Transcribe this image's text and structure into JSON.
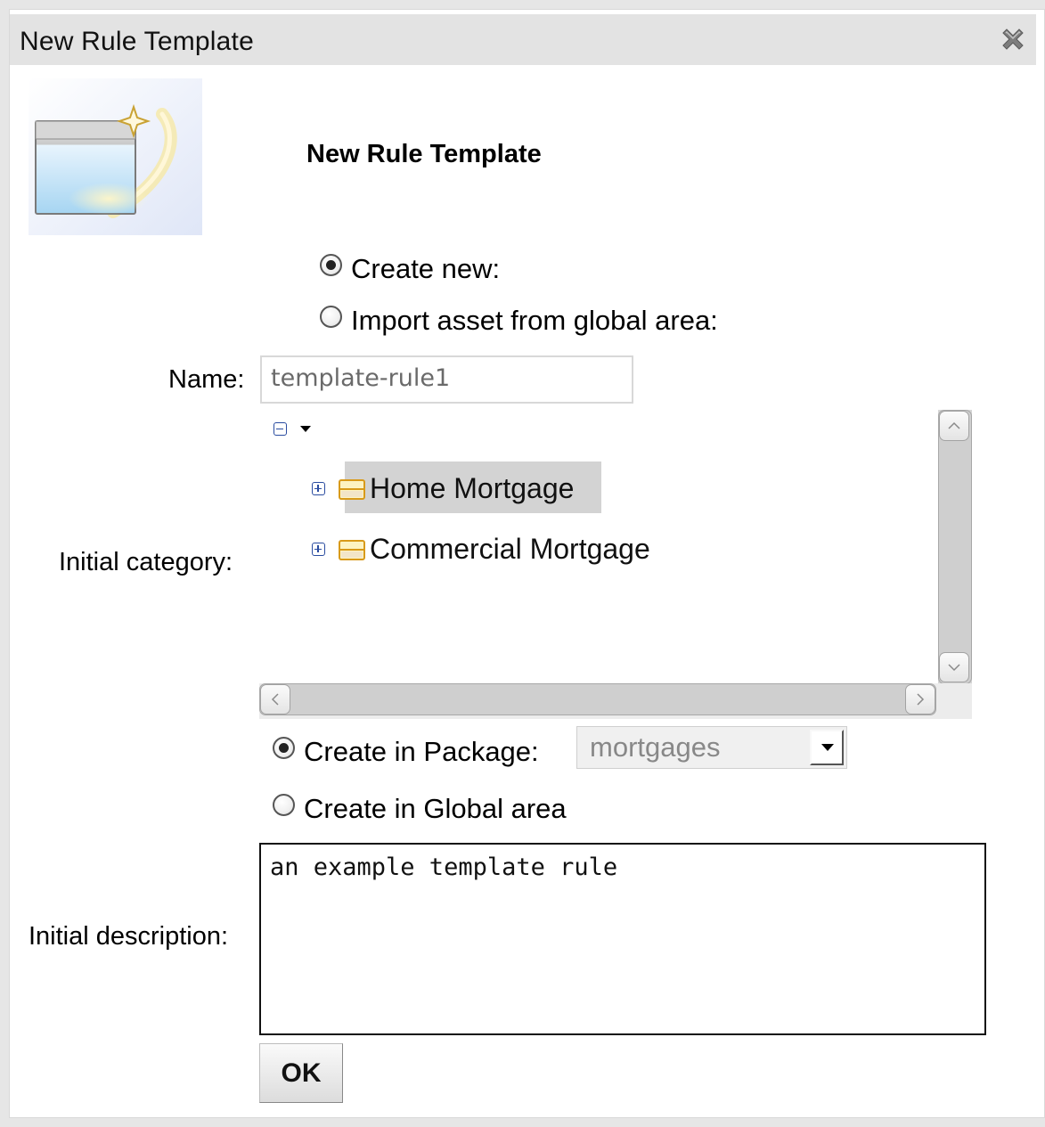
{
  "dialog": {
    "title": "New Rule Template",
    "heading": "New Rule Template"
  },
  "mode": {
    "create_new_label": "Create new:",
    "import_label": "Import asset from global area:",
    "selected": "create_new"
  },
  "form": {
    "name_label": "Name:",
    "name_value": "template-rule1",
    "category_label": "Initial category:",
    "description_label": "Initial description:",
    "description_value": "an example template rule"
  },
  "categories": {
    "items": [
      {
        "label": "Home Mortgage",
        "selected": true
      },
      {
        "label": "Commercial Mortgage",
        "selected": false
      }
    ]
  },
  "location": {
    "package_label": "Create in Package:",
    "package_value": "mortgages",
    "global_label": "Create in Global area",
    "selected": "package"
  },
  "actions": {
    "ok_label": "OK"
  },
  "icons": {
    "close": "close-icon",
    "wizard": "new-window-wizard-icon",
    "category": "category-folder-icon",
    "expand": "expand-plus-icon",
    "collapse": "collapse-minus-icon"
  },
  "colors": {
    "titlebar": "#e3e3e3",
    "selection": "#d3d3d3",
    "tree_toggle": "#2a4ca0",
    "category_icon": "#e0a800"
  }
}
